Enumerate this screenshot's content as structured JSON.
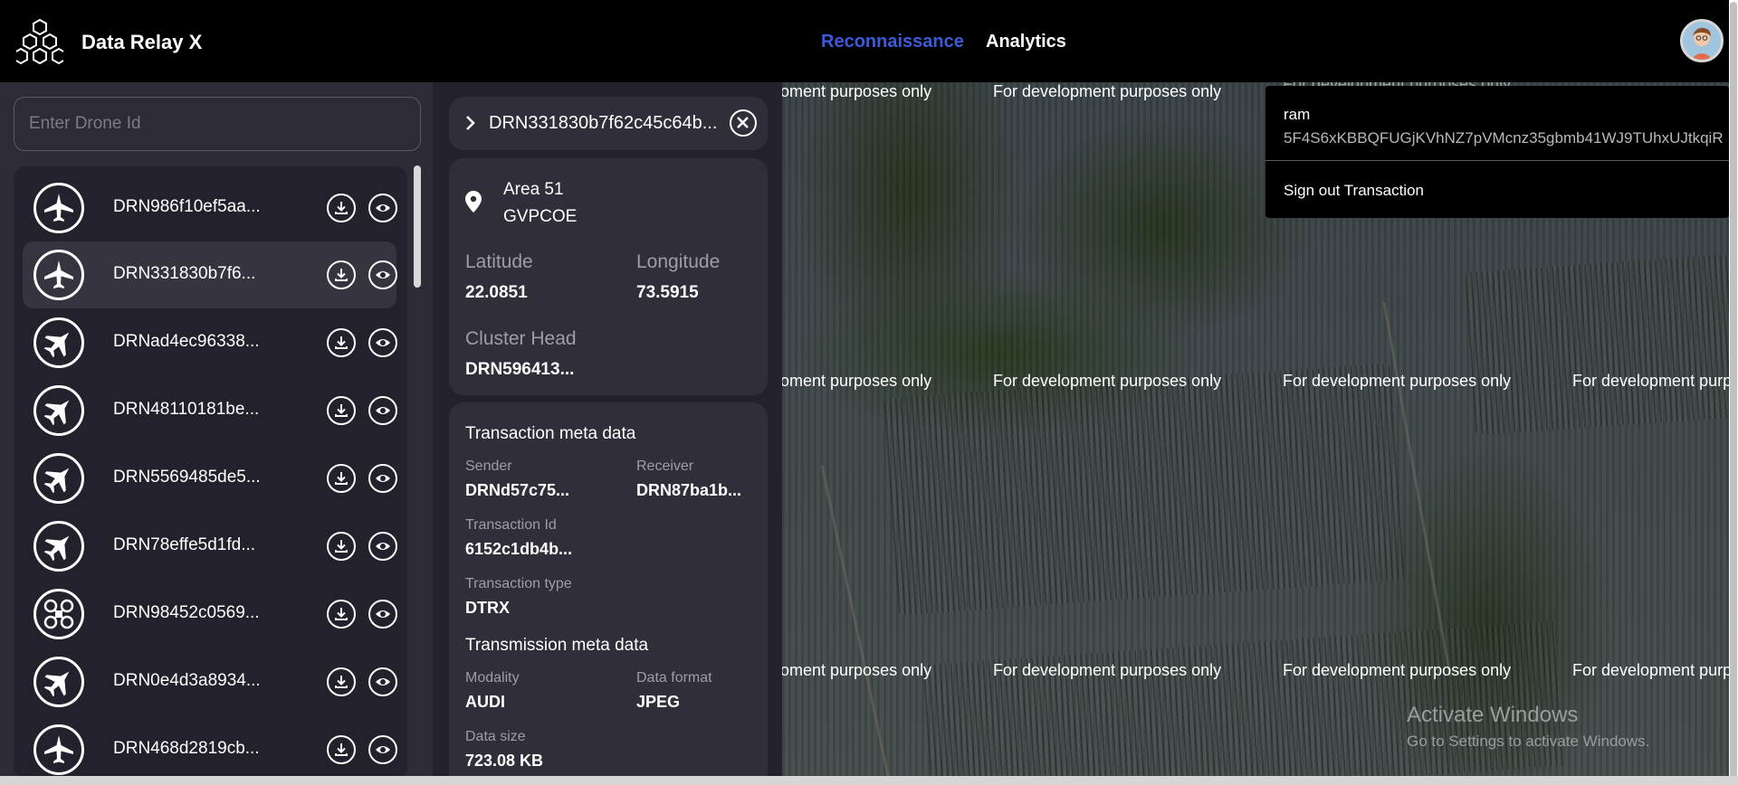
{
  "header": {
    "app_title": "Data Relay X",
    "nav": [
      {
        "label": "Reconnaissance",
        "active": true,
        "color": "#3b5bdb"
      },
      {
        "label": "Analytics",
        "active": false
      }
    ]
  },
  "search": {
    "placeholder": "Enter Drone Id",
    "value": ""
  },
  "drones": [
    {
      "id": "DRN986f10ef5aa...",
      "icon": "airplane-icon"
    },
    {
      "id": "DRN331830b7f6...",
      "icon": "airplane-icon",
      "selected": true
    },
    {
      "id": "DRNad4ec96338...",
      "icon": "fighter-jet-icon"
    },
    {
      "id": "DRN48110181be...",
      "icon": "fighter-jet-icon"
    },
    {
      "id": "DRN5569485de5...",
      "icon": "fighter-jet-icon"
    },
    {
      "id": "DRN78effe5d1fd...",
      "icon": "fighter-jet-icon"
    },
    {
      "id": "DRN98452c0569...",
      "icon": "quadcopter-icon"
    },
    {
      "id": "DRN0e4d3a8934...",
      "icon": "fighter-jet-icon"
    },
    {
      "id": "DRN468d2819cb...",
      "icon": "airplane-icon"
    }
  ],
  "detail": {
    "drone_id": "DRN331830b7f62c45c64b...",
    "location": {
      "line1": "Area 51",
      "line2": "GVPCOE"
    },
    "latitude_label": "Latitude",
    "latitude": "22.0851",
    "longitude_label": "Longitude",
    "longitude": "73.5915",
    "cluster_head_label": "Cluster Head",
    "cluster_head": "DRN596413...",
    "transaction_title": "Transaction meta data",
    "sender_label": "Sender",
    "sender": "DRNd57c75...",
    "receiver_label": "Receiver",
    "receiver": "DRN87ba1b...",
    "transaction_id_label": "Transaction Id",
    "transaction_id": "6152c1db4b...",
    "transaction_type_label": "Transaction type",
    "transaction_type": "DTRX",
    "transmission_title": "Transmission meta data",
    "modality_label": "Modality",
    "modality": "AUDI",
    "data_format_label": "Data format",
    "data_format": "JPEG",
    "data_size_label": "Data size",
    "data_size": "723.08 KB"
  },
  "map": {
    "watermark": "For development purposes only",
    "watermark_clipped_left": "oment purposes only",
    "watermark_clipped_right": "For development purpo",
    "watermark_clipped_top": "For development purposes only"
  },
  "account_popup": {
    "name": "ram",
    "address": "5F4S6xKBBQFUGjKVhNZ7pVMcnz35gbmb41WJ9TUhxUJtkqiR",
    "signout_label": "Sign out Transaction"
  },
  "windows_activation": {
    "title": "Activate Windows",
    "subtitle": "Go to Settings to activate Windows."
  }
}
